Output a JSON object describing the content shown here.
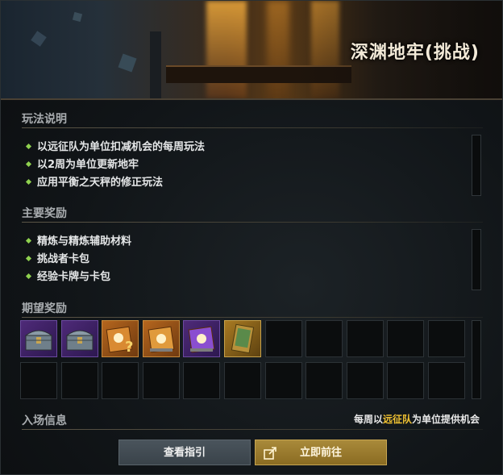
{
  "header": {
    "title": "深渊地牢(挑战)"
  },
  "sections": {
    "rules": {
      "title": "玩法说明",
      "items": [
        "以远征队为单位扣减机会的每周玩法",
        "以2周为单位更新地牢",
        "应用平衡之天秤的修正玩法"
      ]
    },
    "rewards": {
      "title": "主要奖励",
      "items": [
        "精炼与精炼辅助材料",
        "挑战者卡包",
        "经验卡牌与卡包"
      ]
    },
    "expected": {
      "title": "期望奖励",
      "slots": [
        {
          "icon": "treasure-chest-icon",
          "rarity": "purple"
        },
        {
          "icon": "treasure-chest-icon",
          "rarity": "purple"
        },
        {
          "icon": "mystery-book-icon",
          "rarity": "orange"
        },
        {
          "icon": "book-icon",
          "rarity": "orange"
        },
        {
          "icon": "book-icon",
          "rarity": "purple"
        },
        {
          "icon": "card-icon",
          "rarity": "gold"
        }
      ]
    }
  },
  "entry": {
    "label": "入场信息",
    "info_prefix": "每周以",
    "info_highlight": "远征队",
    "info_suffix": "为单位提供机会"
  },
  "buttons": {
    "guide_label": "查看指引",
    "go_label": "立即前往"
  },
  "colors": {
    "accent_gold": "#f1c232",
    "bullet_green": "#8fd14f"
  }
}
